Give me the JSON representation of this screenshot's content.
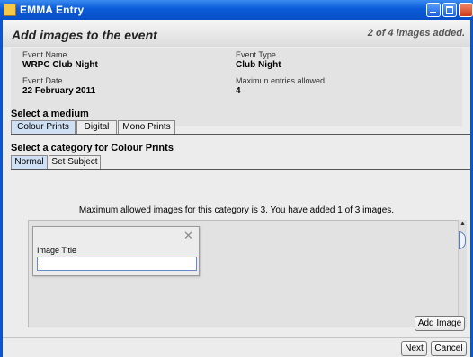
{
  "window": {
    "title": "EMMA Entry"
  },
  "header": {
    "heading": "Add images to the event",
    "images_count": "2 of 4 images added."
  },
  "event": {
    "name_label": "Event Name",
    "name": "WRPC Club Night",
    "type_label": "Event Type",
    "type": "Club Night",
    "date_label": "Event Date",
    "date": "22 February 2011",
    "max_label": "Maximun entries allowed",
    "max": "4"
  },
  "medium": {
    "title": "Select a medium",
    "tabs": [
      "Colour Prints",
      "Digital",
      "Mono Prints"
    ],
    "selected": "Colour Prints"
  },
  "category": {
    "title": "Select a category for Colour Prints",
    "tabs": [
      "Normal",
      "Set Subject"
    ],
    "selected": "Normal"
  },
  "notice": "Maximum allowed images for this category is 3. You have added 1 of 3 images.",
  "image_card": {
    "close_symbol": "✕",
    "title_label": "Image Title",
    "title_value": ""
  },
  "buttons": {
    "add_image": "Add Image",
    "next": "Next",
    "cancel": "Cancel"
  },
  "scrollbar": {
    "up": "▲",
    "down": "▼"
  },
  "colors": {
    "titlebar": "#0a5ad8",
    "accent_tab": "#cfe0f5",
    "background": "#ececec"
  }
}
